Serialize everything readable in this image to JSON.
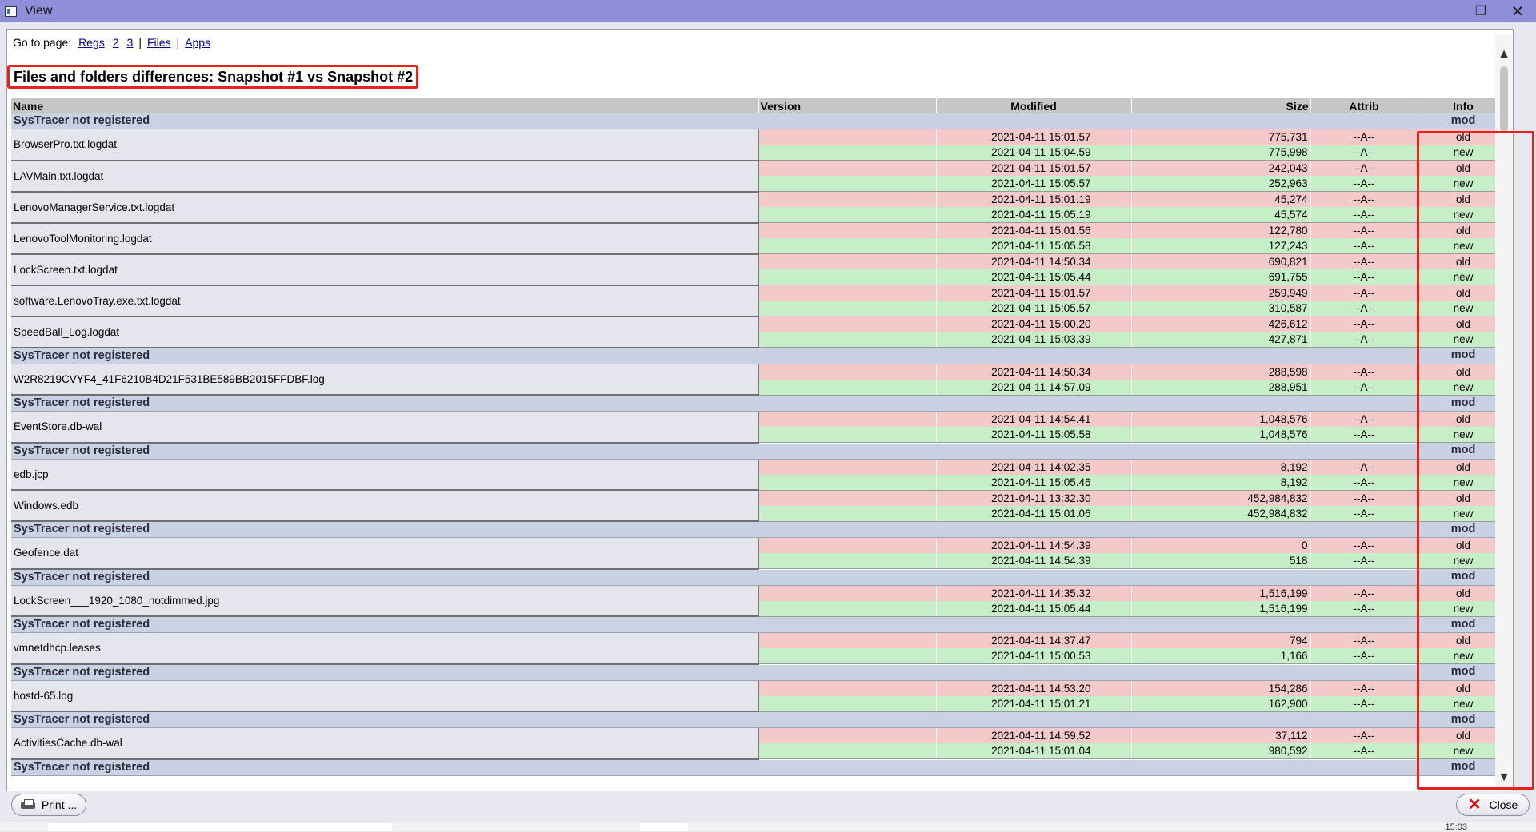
{
  "window": {
    "title": "View",
    "minimize": "—",
    "maximize": "❐",
    "close": "✕"
  },
  "goto": {
    "label": "Go to page:",
    "links": [
      "Regs",
      "2",
      "3",
      "Files",
      "Apps"
    ]
  },
  "heading": "Files and folders differences: Snapshot #1 vs Snapshot #2",
  "columns": [
    "Name",
    "Version",
    "Modified",
    "Size",
    "Attrib",
    "Info"
  ],
  "groups": [
    {
      "label": "SysTracer not registered",
      "info": "mod",
      "files": [
        {
          "name": "BrowserPro.txt.logdat",
          "old": {
            "modified": "2021-04-11 15:01.57",
            "size": "775,731",
            "attrib": "--A--",
            "info": "old"
          },
          "new": {
            "modified": "2021-04-11 15:04.59",
            "size": "775,998",
            "attrib": "--A--",
            "info": "new"
          }
        },
        {
          "name": "LAVMain.txt.logdat",
          "old": {
            "modified": "2021-04-11 15:01.57",
            "size": "242,043",
            "attrib": "--A--",
            "info": "old"
          },
          "new": {
            "modified": "2021-04-11 15:05.57",
            "size": "252,963",
            "attrib": "--A--",
            "info": "new"
          }
        },
        {
          "name": "LenovoManagerService.txt.logdat",
          "old": {
            "modified": "2021-04-11 15:01.19",
            "size": "45,274",
            "attrib": "--A--",
            "info": "old"
          },
          "new": {
            "modified": "2021-04-11 15:05.19",
            "size": "45,574",
            "attrib": "--A--",
            "info": "new"
          }
        },
        {
          "name": "LenovoToolMonitoring.logdat",
          "old": {
            "modified": "2021-04-11 15:01.56",
            "size": "122,780",
            "attrib": "--A--",
            "info": "old"
          },
          "new": {
            "modified": "2021-04-11 15:05.58",
            "size": "127,243",
            "attrib": "--A--",
            "info": "new"
          }
        },
        {
          "name": "LockScreen.txt.logdat",
          "old": {
            "modified": "2021-04-11 14:50.34",
            "size": "690,821",
            "attrib": "--A--",
            "info": "old"
          },
          "new": {
            "modified": "2021-04-11 15:05.44",
            "size": "691,755",
            "attrib": "--A--",
            "info": "new"
          }
        },
        {
          "name": "software.LenovoTray.exe.txt.logdat",
          "old": {
            "modified": "2021-04-11 15:01.57",
            "size": "259,949",
            "attrib": "--A--",
            "info": "old"
          },
          "new": {
            "modified": "2021-04-11 15:05.57",
            "size": "310,587",
            "attrib": "--A--",
            "info": "new"
          }
        },
        {
          "name": "SpeedBall_Log.logdat",
          "old": {
            "modified": "2021-04-11 15:00.20",
            "size": "426,612",
            "attrib": "--A--",
            "info": "old"
          },
          "new": {
            "modified": "2021-04-11 15:03.39",
            "size": "427,871",
            "attrib": "--A--",
            "info": "new"
          }
        }
      ]
    },
    {
      "label": "SysTracer not registered",
      "info": "mod",
      "files": [
        {
          "name": "W2R8219CVYF4_41F6210B4D21F531BE589BB2015FFDBF.log",
          "old": {
            "modified": "2021-04-11 14:50.34",
            "size": "288,598",
            "attrib": "--A--",
            "info": "old"
          },
          "new": {
            "modified": "2021-04-11 14:57.09",
            "size": "288,951",
            "attrib": "--A--",
            "info": "new"
          }
        }
      ]
    },
    {
      "label": "SysTracer not registered",
      "info": "mod",
      "files": [
        {
          "name": "EventStore.db-wal",
          "old": {
            "modified": "2021-04-11 14:54.41",
            "size": "1,048,576",
            "attrib": "--A--",
            "info": "old"
          },
          "new": {
            "modified": "2021-04-11 15:05.58",
            "size": "1,048,576",
            "attrib": "--A--",
            "info": "new"
          }
        }
      ]
    },
    {
      "label": "SysTracer not registered",
      "info": "mod",
      "files": [
        {
          "name": "edb.jcp",
          "old": {
            "modified": "2021-04-11 14:02.35",
            "size": "8,192",
            "attrib": "--A--",
            "info": "old"
          },
          "new": {
            "modified": "2021-04-11 15:05.46",
            "size": "8,192",
            "attrib": "--A--",
            "info": "new"
          }
        },
        {
          "name": "Windows.edb",
          "old": {
            "modified": "2021-04-11 13:32.30",
            "size": "452,984,832",
            "attrib": "--A--",
            "info": "old"
          },
          "new": {
            "modified": "2021-04-11 15:01.06",
            "size": "452,984,832",
            "attrib": "--A--",
            "info": "new"
          }
        }
      ]
    },
    {
      "label": "SysTracer not registered",
      "info": "mod",
      "files": [
        {
          "name": "Geofence.dat",
          "old": {
            "modified": "2021-04-11 14:54.39",
            "size": "0",
            "attrib": "--A--",
            "info": "old"
          },
          "new": {
            "modified": "2021-04-11 14:54.39",
            "size": "518",
            "attrib": "--A--",
            "info": "new"
          }
        }
      ]
    },
    {
      "label": "SysTracer not registered",
      "info": "mod",
      "files": [
        {
          "name": "LockScreen___1920_1080_notdimmed.jpg",
          "old": {
            "modified": "2021-04-11 14:35.32",
            "size": "1,516,199",
            "attrib": "--A--",
            "info": "old"
          },
          "new": {
            "modified": "2021-04-11 15:05.44",
            "size": "1,516,199",
            "attrib": "--A--",
            "info": "new"
          }
        }
      ]
    },
    {
      "label": "SysTracer not registered",
      "info": "mod",
      "files": [
        {
          "name": "vmnetdhcp.leases",
          "old": {
            "modified": "2021-04-11 14:37.47",
            "size": "794",
            "attrib": "--A--",
            "info": "old"
          },
          "new": {
            "modified": "2021-04-11 15:00.53",
            "size": "1,166",
            "attrib": "--A--",
            "info": "new"
          }
        }
      ]
    },
    {
      "label": "SysTracer not registered",
      "info": "mod",
      "files": [
        {
          "name": "hostd-65.log",
          "old": {
            "modified": "2021-04-11 14:53.20",
            "size": "154,286",
            "attrib": "--A--",
            "info": "old"
          },
          "new": {
            "modified": "2021-04-11 15:01.21",
            "size": "162,900",
            "attrib": "--A--",
            "info": "new"
          }
        }
      ]
    },
    {
      "label": "SysTracer not registered",
      "info": "mod",
      "files": [
        {
          "name": "ActivitiesCache.db-wal",
          "old": {
            "modified": "2021-04-11 14:59.52",
            "size": "37,112",
            "attrib": "--A--",
            "info": "old"
          },
          "new": {
            "modified": "2021-04-11 15:01.04",
            "size": "980,592",
            "attrib": "--A--",
            "info": "new"
          }
        }
      ]
    },
    {
      "label": "SysTracer not registered",
      "info": "mod",
      "files": []
    }
  ],
  "buttons": {
    "print": "Print ...",
    "close": "Close"
  },
  "taskbar": {
    "clock": "15:03"
  },
  "colors": {
    "title_bar": "#8f8ed8",
    "old_row": "#f3c9c9",
    "new_row": "#c7efc7",
    "group_row": "#c8d2e2",
    "highlight": "#e8201e"
  },
  "icons": {
    "window": "window-icon",
    "print": "printer-icon",
    "close": "x-icon",
    "scroll_up": "chevron-up-icon",
    "scroll_down": "chevron-down-icon"
  }
}
